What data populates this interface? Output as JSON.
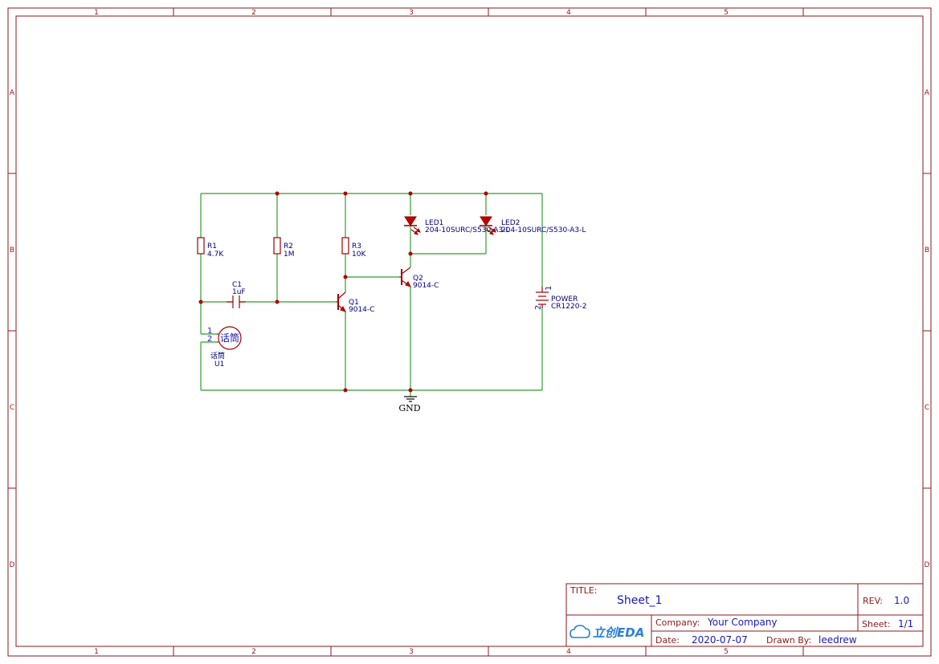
{
  "sheet": {
    "zones_top": [
      "1",
      "2",
      "3",
      "4",
      "5"
    ],
    "zones_bottom": [
      "1",
      "2",
      "3",
      "4",
      "5"
    ],
    "zones_left": [
      "A",
      "B",
      "C",
      "D"
    ],
    "zones_right": [
      "A",
      "B",
      "C",
      "D"
    ]
  },
  "components": {
    "r1": {
      "ref": "R1",
      "value": "4.7K"
    },
    "r2": {
      "ref": "R2",
      "value": "1M"
    },
    "r3": {
      "ref": "R3",
      "value": "10K"
    },
    "c1": {
      "ref": "C1",
      "value": "1uF"
    },
    "q1": {
      "ref": "Q1",
      "value": "9014-C"
    },
    "q2": {
      "ref": "Q2",
      "value": "9014-C"
    },
    "led1": {
      "ref": "LED1",
      "value": "204-10SURC/S530-A3-L"
    },
    "led2": {
      "ref": "LED2",
      "value": "204-10SURC/S530-A3-L"
    },
    "power": {
      "ref": "POWER",
      "value": "CR1220-2",
      "pin1": "1",
      "pin2": "2"
    },
    "u1": {
      "ref": "U1",
      "value": "话筒",
      "body_text": "话筒",
      "pin1": "1",
      "pin2": "2"
    },
    "gnd": {
      "label": "GND"
    }
  },
  "title_block": {
    "title_label": "TITLE:",
    "title": "Sheet_1",
    "rev_label": "REV:",
    "rev": "1.0",
    "company_label": "Company:",
    "company": "Your Company",
    "sheet_label": "Sheet:",
    "sheet": "1/1",
    "date_label": "Date:",
    "date": "2020-07-07",
    "drawn_by_label": "Drawn By:",
    "drawn_by": "leedrew",
    "logo_text": "立创EDA"
  },
  "colors": {
    "frame": "#8b1a1a",
    "wire": "#2e9e2e",
    "component": "#a00000",
    "label_text": "#00007a",
    "logo": "#2b7fd6"
  }
}
